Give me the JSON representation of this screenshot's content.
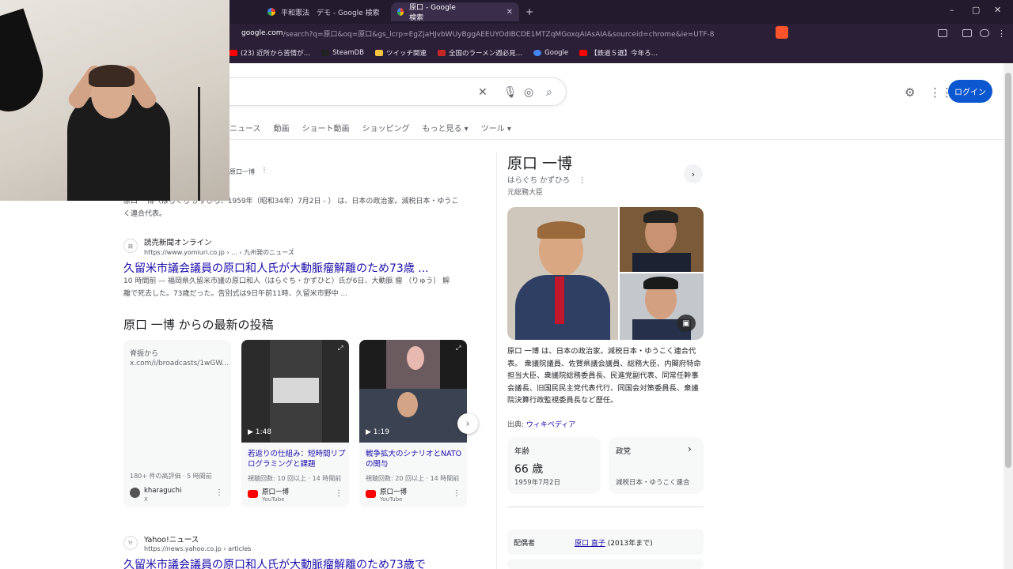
{
  "browser": {
    "tabs": [
      {
        "title": "平和憲法　デモ - Google 検索",
        "active": false
      },
      {
        "title": "原口 - Google 検索",
        "active": true
      }
    ],
    "new_tab": "+",
    "window_controls": [
      "–",
      "▢",
      "✕"
    ],
    "address": {
      "host": "google.com",
      "path": "/search?q=原口&oq=原口&gs_lcrp=EgZjaHJvbWUyBggAEEUYOdIBCDE1MTZqMGoxqAIAsAIA&sourceid=chrome&ie=UTF-8"
    },
    "bookmarks": [
      {
        "label": "(23) 近所から苦情が…",
        "color": "#ff0000"
      },
      {
        "label": "SteamDB",
        "color": "#222222"
      },
      {
        "label": "ツイッチ関連",
        "color": "#f5c542"
      },
      {
        "label": "全国のラーメン週必見…",
        "color": "#c62828"
      },
      {
        "label": "Google",
        "color": "#4285f4"
      },
      {
        "label": "【鉄道５選】今年ろ…",
        "color": "#ff0000"
      }
    ]
  },
  "google": {
    "login_label": "ログイン",
    "nav_tabs": [
      "ニュース",
      "動画",
      "ショート動画",
      "ショッピング",
      "もっと見る ▾",
      "ツール ▾"
    ],
    "results": [
      {
        "source_fragment": "原口一博",
        "snippet_line1": "原口 一博（はらぐち かずひろ、1959年（昭和34年）7月2日 - ） は、日本の政治家。減税日本・ゆうこ",
        "snippet_line2": "く連合代表。"
      },
      {
        "source": "読売新聞オンライン",
        "url": "https://www.yomiuri.co.jp › ... › 九州発のニュース",
        "title": "久留米市議会議員の原口和人氏が大動脈瘤解離のため73歳 ...",
        "snippet_line1": "10 時間前 — 福岡県久留米市議の原口和人（はらぐち・かずひと）氏が6日、大動脈 瘤 （りゅう） 解",
        "snippet_line2": "離で死去した。73歳だった。告別式は9日午前11時、久留米市野中 ..."
      },
      {
        "source": "Yahoo!ニュース",
        "url": "https://news.yahoo.co.jp › articles",
        "title": "久留米市議会議員の原口和人氏が大動脈瘤解離のため73歳で"
      }
    ],
    "posts_section_title": "原口 一博 からの最新の投稿",
    "posts": [
      {
        "line1": "脊振から",
        "line2": "x.com/i/broadcasts/1wGW...",
        "meta": "180+ 件の高評価 · 5 時間前",
        "author": "kharaguchi",
        "source": "X"
      },
      {
        "duration": "▶ 1:48",
        "title": "若返りの仕組み：短時間リプログラミングと課題",
        "meta": "視聴回数: 10 回以上 · 14 時間前",
        "author": "原口一博",
        "source": "YouTube"
      },
      {
        "duration": "▶ 1:19",
        "title": "戦争拡大のシナリオとNATOの関与",
        "meta": "視聴回数: 20 回以上 · 14 時間前",
        "author": "原口一博",
        "source": "YouTube"
      }
    ],
    "knowledge_panel": {
      "name": "原口 一博",
      "reading": "はらぐち かずひろ",
      "role": "元総務大臣",
      "description": "原口 一博 は、日本の政治家。減税日本・ゆうこく連合代表。 衆議院議員、佐賀県議会議員、総務大臣、内閣府特命担当大臣、衆議院総務委員長、民進党副代表、同常任幹事会議長、旧国民民主党代表代行、同国会対策委員長、衆議院決算行政監視委員長など歴任。",
      "source_label": "出典:",
      "source_link": "ウィキペディア",
      "facts": [
        {
          "label": "年齢",
          "value": "66 歳",
          "sub": "1959年7月2日"
        },
        {
          "label": "政党",
          "value": "",
          "sub": "減税日本・ゆうこく連合"
        }
      ],
      "spouse": {
        "label": "配偶者",
        "name": "原口 直子",
        "note": " (2013年まで)"
      }
    }
  }
}
